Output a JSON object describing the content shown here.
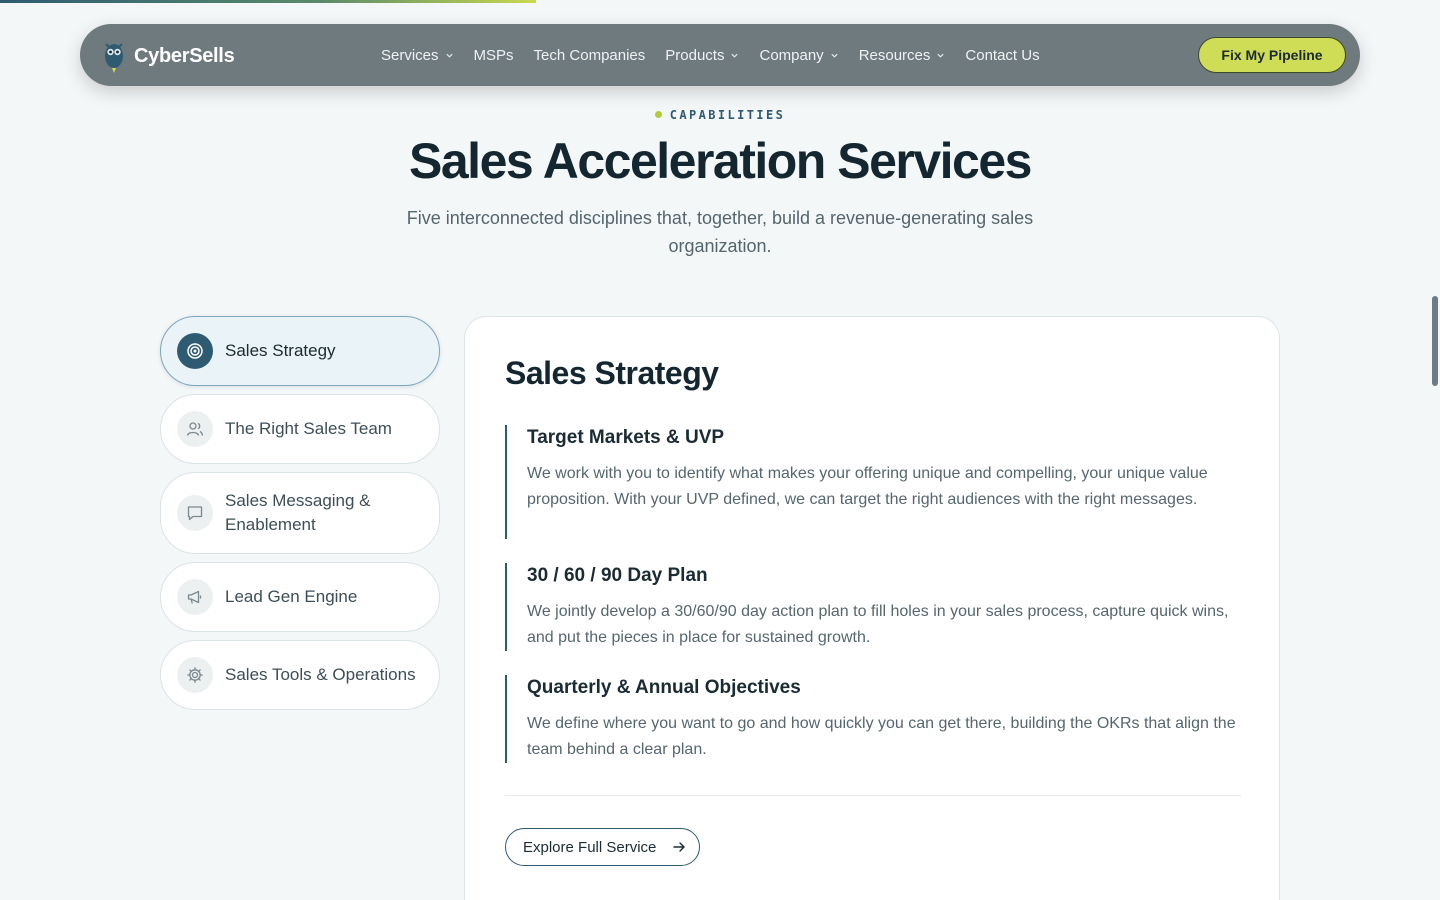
{
  "progress": {
    "fraction": 0.372
  },
  "nav": {
    "brand": "CyberSells",
    "links": [
      {
        "label": "Services",
        "dropdown": true
      },
      {
        "label": "MSPs",
        "dropdown": false
      },
      {
        "label": "Tech Companies",
        "dropdown": false
      },
      {
        "label": "Products",
        "dropdown": true
      },
      {
        "label": "Company",
        "dropdown": true
      },
      {
        "label": "Resources",
        "dropdown": true
      },
      {
        "label": "Contact Us",
        "dropdown": false
      }
    ],
    "cta": "Fix My Pipeline"
  },
  "hero": {
    "eyebrow": "CAPABILITIES",
    "title": "Sales Acceleration Services",
    "subtitle": "Five interconnected disciplines that, together, build a revenue-generating sales organization."
  },
  "tabs": [
    {
      "label": "Sales Strategy",
      "icon": "target-icon",
      "active": true
    },
    {
      "label": "The Right Sales Team",
      "icon": "users-icon",
      "active": false
    },
    {
      "label": "Sales Messaging & Enablement",
      "icon": "message-icon",
      "active": false
    },
    {
      "label": "Lead Gen Engine",
      "icon": "megaphone-icon",
      "active": false
    },
    {
      "label": "Sales Tools & Operations",
      "icon": "gear-icon",
      "active": false
    }
  ],
  "panel": {
    "title": "Sales Strategy",
    "blocks": [
      {
        "title": "Target Markets & UVP",
        "text": "We work with you to identify what makes your offering unique and compelling, your unique value proposition. With your UVP defined, we can target the right audiences with the right messages."
      },
      {
        "title": "30 / 60 / 90 Day Plan",
        "text": "We jointly develop a 30/60/90 day action plan to fill holes in your sales process, capture quick wins, and put the pieces in place for sustained growth."
      },
      {
        "title": "Quarterly & Annual Objectives",
        "text": "We define where you want to go and how quickly you can get there, building the OKRs that align the team behind a clear plan."
      }
    ],
    "cta": "Explore Full Service"
  },
  "colors": {
    "accent": "#2f5b72",
    "lime": "#cfdc55",
    "nav_bg": "#6f7a7f",
    "page_bg": "#f4f7f8"
  }
}
